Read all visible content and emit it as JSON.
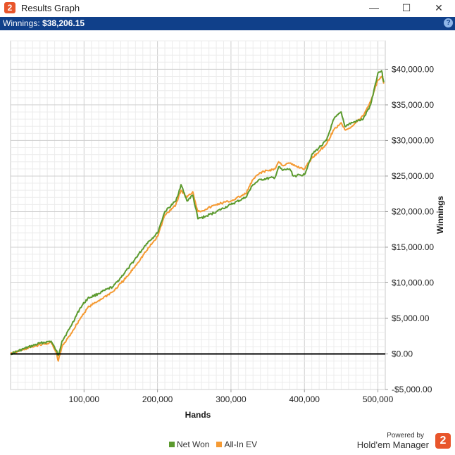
{
  "window": {
    "title": "Results Graph",
    "app_badge": "2",
    "minimize_glyph": "—",
    "maximize_glyph": "☐",
    "close_glyph": "✕"
  },
  "status": {
    "winnings_label": "Winnings:",
    "winnings_value": "$38,206.15",
    "help_glyph": "?"
  },
  "brand": {
    "powered_by": "Powered by",
    "name": "Hold'em Manager",
    "logo_badge": "2"
  },
  "colors": {
    "net_won": "#5b9a2e",
    "all_in_ev": "#f59a33",
    "statusbar": "#10408a",
    "accent": "#e8552b"
  },
  "chart_data": {
    "type": "line",
    "xlabel": "Hands",
    "ylabel": "Winnings",
    "xlim": [
      0,
      510000
    ],
    "ylim": [
      -5000,
      44000
    ],
    "x_ticks": [
      100000,
      200000,
      300000,
      400000,
      500000
    ],
    "x_tick_labels": [
      "100,000",
      "200,000",
      "300,000",
      "400,000",
      "500,000"
    ],
    "y_ticks": [
      -5000,
      0,
      5000,
      10000,
      15000,
      20000,
      25000,
      30000,
      35000,
      40000
    ],
    "y_tick_labels": [
      "-$5,000.00",
      "$0.00",
      "$5,000.00",
      "$10,000.00",
      "$15,000.00",
      "$20,000.00",
      "$25,000.00",
      "$30,000.00",
      "$35,000.00",
      "$40,000.00"
    ],
    "grid": true,
    "legend_position": "bottom-center",
    "series": [
      {
        "name": "Net Won",
        "color": "#5b9a2e",
        "x": [
          0,
          20000,
          40000,
          55000,
          62000,
          65000,
          70000,
          80000,
          95000,
          105000,
          120000,
          140000,
          160000,
          185000,
          200000,
          210000,
          225000,
          232000,
          240000,
          248000,
          255000,
          265000,
          280000,
          300000,
          320000,
          330000,
          340000,
          360000,
          365000,
          370000,
          380000,
          385000,
          400000,
          410000,
          420000,
          430000,
          440000,
          450000,
          455000,
          465000,
          480000,
          490000,
          500000,
          505000,
          508000
        ],
        "y": [
          0,
          800,
          1500,
          1800,
          500,
          -200,
          1800,
          3500,
          6500,
          7800,
          8500,
          9500,
          12000,
          15500,
          17000,
          20000,
          21500,
          23800,
          21500,
          22300,
          19000,
          19300,
          20000,
          21000,
          22000,
          23800,
          24500,
          24800,
          26300,
          25800,
          26000,
          25000,
          25200,
          28000,
          29000,
          30000,
          33000,
          34000,
          32000,
          32500,
          33000,
          35000,
          39500,
          39800,
          38200
        ]
      },
      {
        "name": "All-In EV",
        "color": "#f59a33",
        "x": [
          0,
          20000,
          40000,
          55000,
          62000,
          65000,
          70000,
          80000,
          95000,
          105000,
          120000,
          140000,
          160000,
          185000,
          200000,
          210000,
          225000,
          232000,
          240000,
          248000,
          255000,
          265000,
          280000,
          300000,
          320000,
          330000,
          340000,
          360000,
          365000,
          370000,
          380000,
          385000,
          400000,
          410000,
          420000,
          430000,
          440000,
          450000,
          455000,
          465000,
          480000,
          490000,
          500000,
          505000,
          508000
        ],
        "y": [
          0,
          700,
          1300,
          1600,
          200,
          -1000,
          1000,
          2500,
          5000,
          6500,
          7500,
          8800,
          11000,
          14500,
          16500,
          19500,
          21000,
          23000,
          22000,
          22800,
          20000,
          20300,
          21000,
          21500,
          22500,
          24500,
          25500,
          26000,
          27000,
          26500,
          26800,
          26500,
          26000,
          27500,
          28500,
          29500,
          31500,
          32500,
          31500,
          32000,
          33500,
          35500,
          38500,
          39000,
          38000
        ]
      }
    ]
  }
}
